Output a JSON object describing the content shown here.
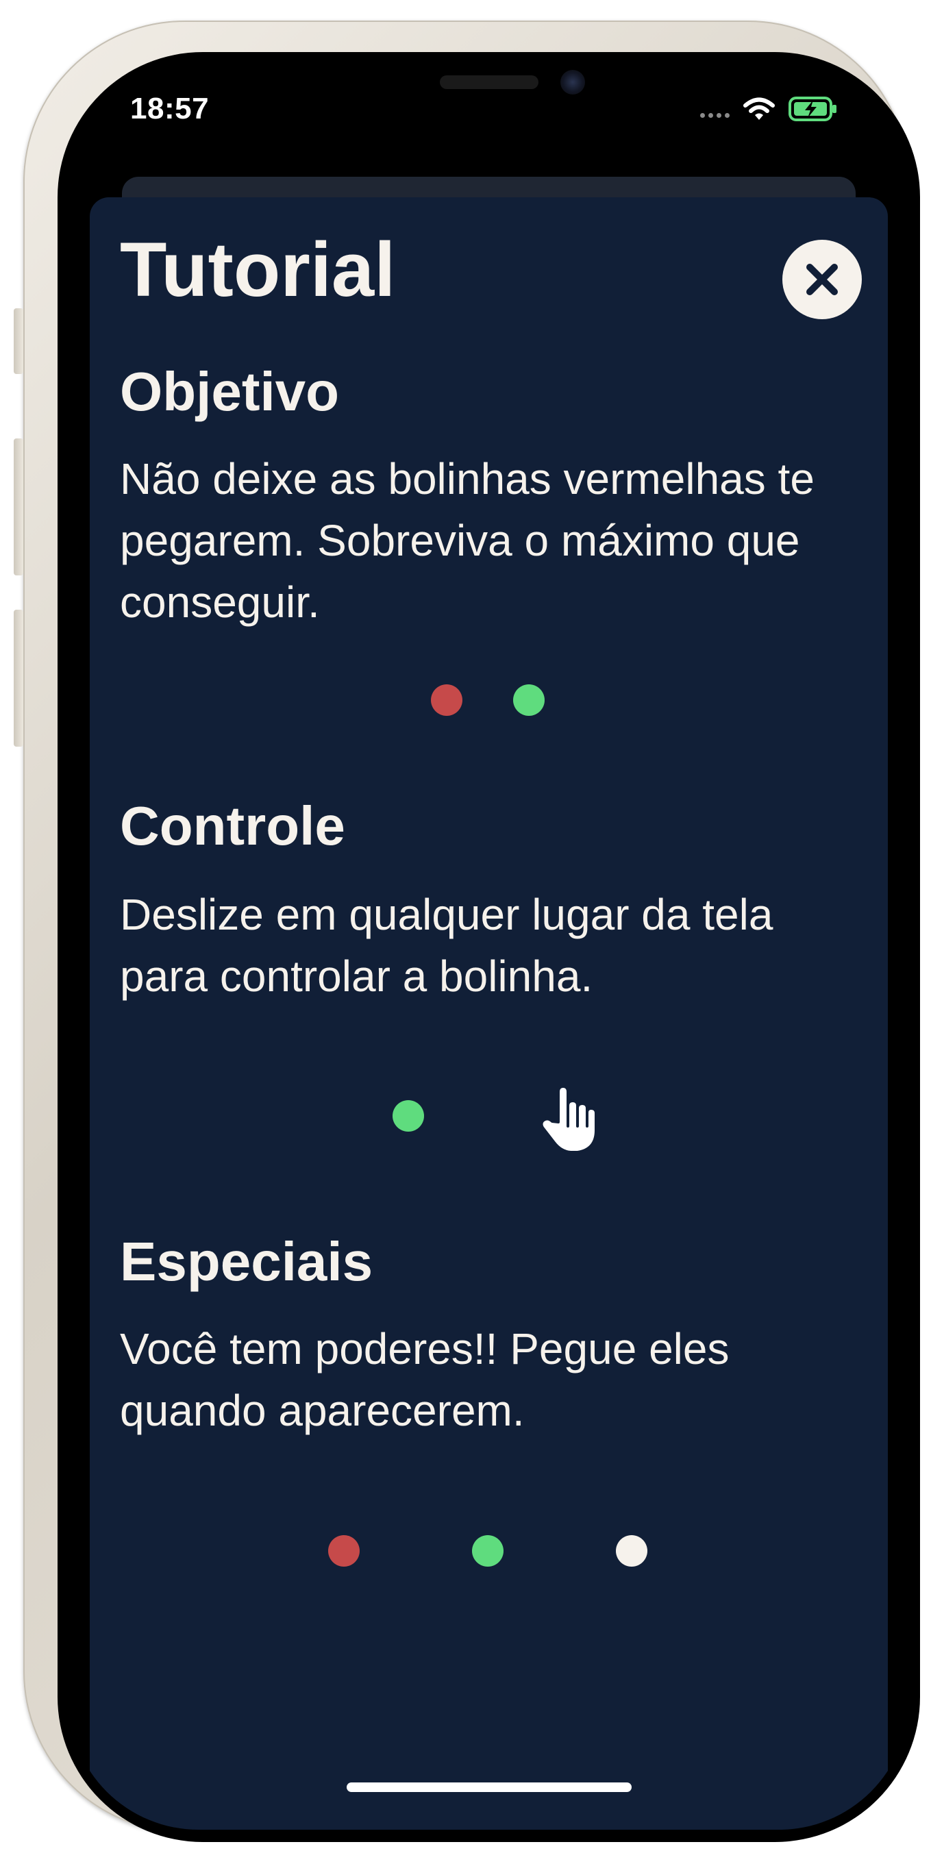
{
  "status_bar": {
    "time": "18:57"
  },
  "tutorial": {
    "title": "Tutorial",
    "close_icon": "close-icon"
  },
  "sections": [
    {
      "title": "Objetivo",
      "text": "Não deixe as bolinhas vermelhas te pegarem. Sobreviva o máximo que conseguir.",
      "dots": [
        "red",
        "green"
      ]
    },
    {
      "title": "Controle",
      "text": "Deslize em qualquer lugar da tela para controlar a bolinha.",
      "dots": [
        "green"
      ],
      "icon": "hand-pointer-icon"
    },
    {
      "title": "Especiais",
      "text": "Você tem poderes!! Pegue eles quando aparecerem.",
      "dots": [
        "red",
        "green",
        "white"
      ]
    }
  ],
  "colors": {
    "background": "#111f37",
    "text": "#f6f2ec",
    "red": "#c64a4a",
    "green": "#5fdc7e",
    "white": "#f6f2ec"
  }
}
